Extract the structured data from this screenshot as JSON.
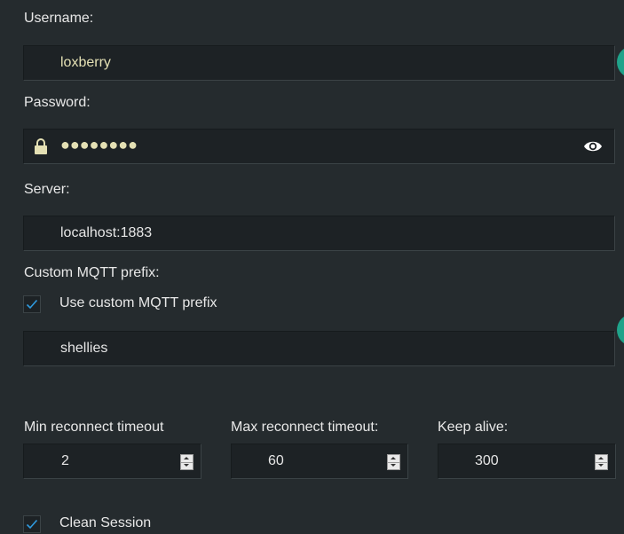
{
  "username": {
    "label": "Username:",
    "value": "loxberry"
  },
  "password": {
    "label": "Password:",
    "masked_value": "●●●●●●●●",
    "lock_icon": "lock-icon",
    "reveal_icon": "eye-icon"
  },
  "server": {
    "label": "Server:",
    "value": "localhost:1883"
  },
  "mqtt_prefix": {
    "label": "Custom MQTT prefix:",
    "checkbox_label": "Use custom MQTT prefix",
    "checked": true,
    "value": "shellies"
  },
  "timeouts": {
    "min_reconnect": {
      "label": "Min reconnect timeout",
      "value": "2"
    },
    "max_reconnect": {
      "label": "Max reconnect timeout:",
      "value": "60"
    },
    "keep_alive": {
      "label": "Keep alive:",
      "value": "300"
    }
  },
  "clean_session": {
    "label": "Clean Session",
    "checked": true
  },
  "colors": {
    "background": "#252b2e",
    "field_background": "#1d2225",
    "value_text": "#e4e0b4",
    "accent": "#1fa38a",
    "check": "#2f9be0"
  }
}
